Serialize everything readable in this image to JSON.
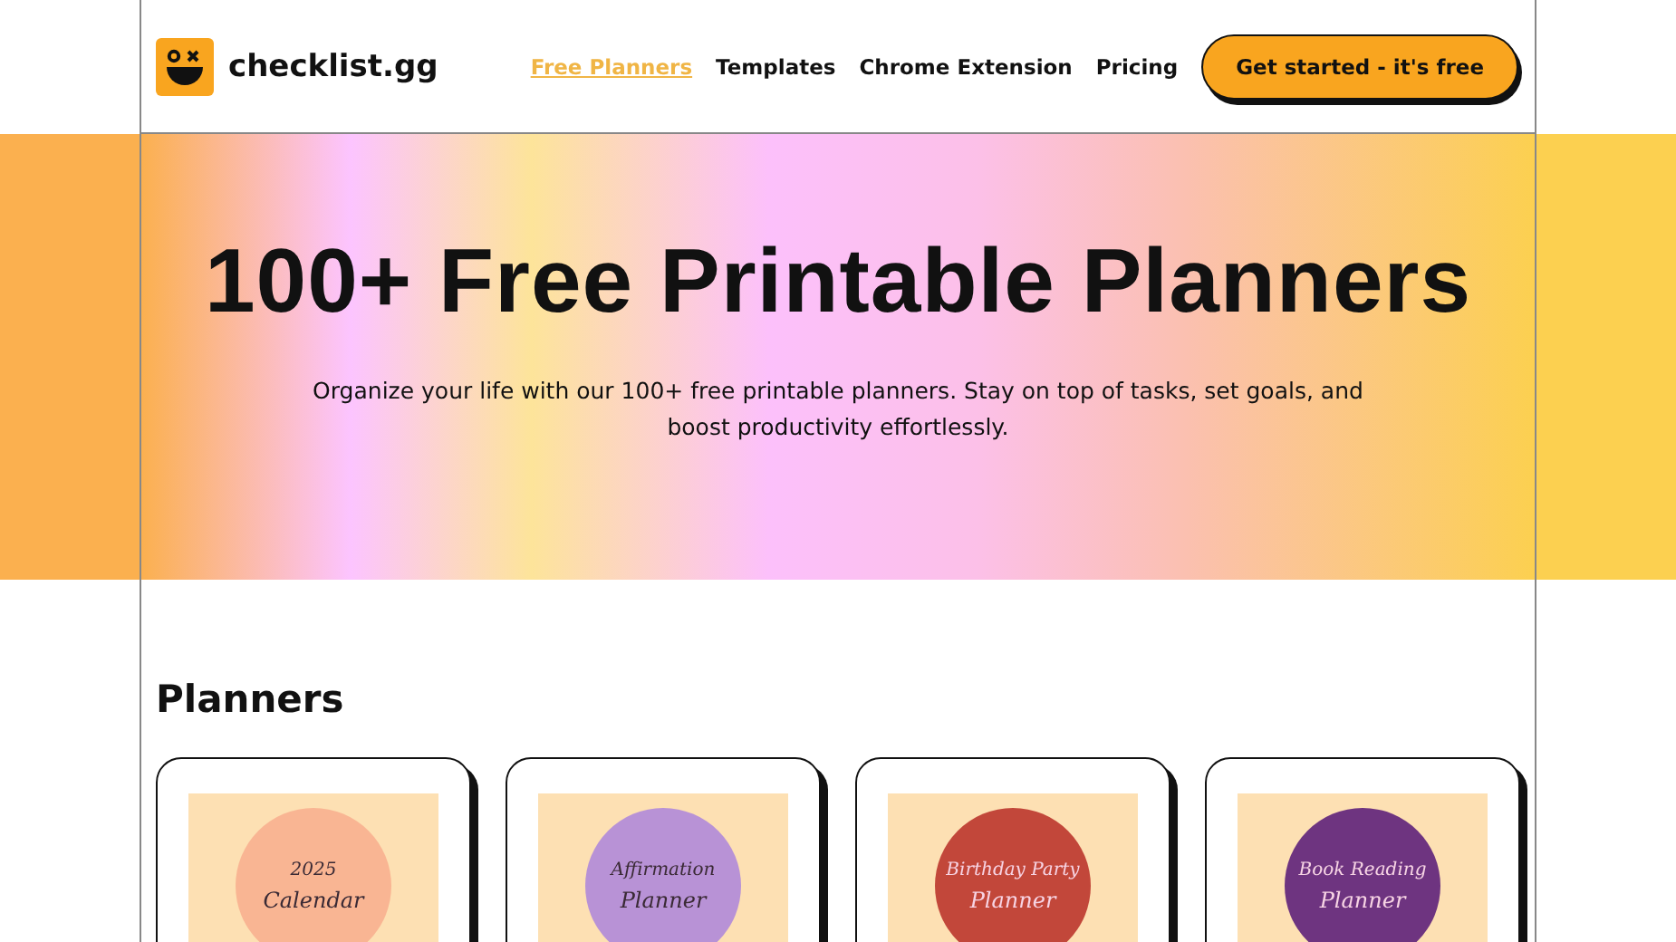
{
  "header": {
    "brand": "checklist.gg",
    "nav": [
      {
        "label": "Free Planners",
        "selected": true
      },
      {
        "label": "Templates",
        "selected": false
      },
      {
        "label": "Chrome Extension",
        "selected": false
      },
      {
        "label": "Pricing",
        "selected": false
      }
    ],
    "cta": "Get started - it's free"
  },
  "hero": {
    "title": "100+ Free Printable Planners",
    "subtitle": "Organize your life with our 100+ free printable planners. Stay on top of tasks, set goals, and boost productivity effortlessly."
  },
  "section": {
    "heading": "Planners",
    "cards": [
      {
        "cover_lines": [
          "2025",
          "Calendar"
        ],
        "color": "#f9b593",
        "light_text": false
      },
      {
        "cover_lines": [
          "Affirmation",
          "Planner"
        ],
        "color": "#b892d6",
        "light_text": false
      },
      {
        "cover_lines": [
          "Birthday Party",
          "Planner"
        ],
        "color": "#c2473a",
        "light_text": true
      },
      {
        "cover_lines": [
          "Book Reading",
          "Planner"
        ],
        "color": "#6e3480",
        "light_text": true
      }
    ]
  }
}
